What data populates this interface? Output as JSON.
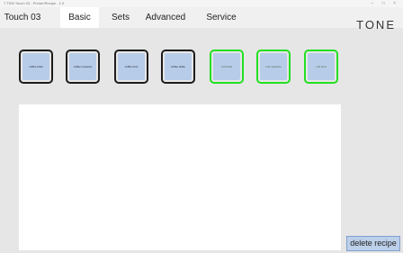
{
  "window": {
    "caption": "T TEM Touch 03 - Printer/Recipe - 1.0",
    "controls": "– □ ×"
  },
  "tabs": [
    {
      "label": "Touch 03"
    },
    {
      "label": "Basic"
    },
    {
      "label": "Sets"
    },
    {
      "label": "Advanced"
    },
    {
      "label": "Service"
    }
  ],
  "active_tab": "Basic",
  "brand": "TONE",
  "recipes": [
    {
      "label": "coffee kriek",
      "state": "assigned"
    },
    {
      "label": "coffee measure",
      "state": "assigned"
    },
    {
      "label": "coffee kont",
      "state": "assigned"
    },
    {
      "label": "coffee skate",
      "state": "assigned"
    },
    {
      "label": "unit kriek",
      "state": "empty"
    },
    {
      "label": "unit measure",
      "state": "empty"
    },
    {
      "label": "unit kont",
      "state": "empty"
    }
  ],
  "actions": {
    "delete_recipe": "delete recipe"
  },
  "colors": {
    "assigned_border": "#1c1c1c",
    "empty_border": "#22e022",
    "tile_fill": "#b7cce8",
    "button_fill": "#bcd0ea"
  }
}
